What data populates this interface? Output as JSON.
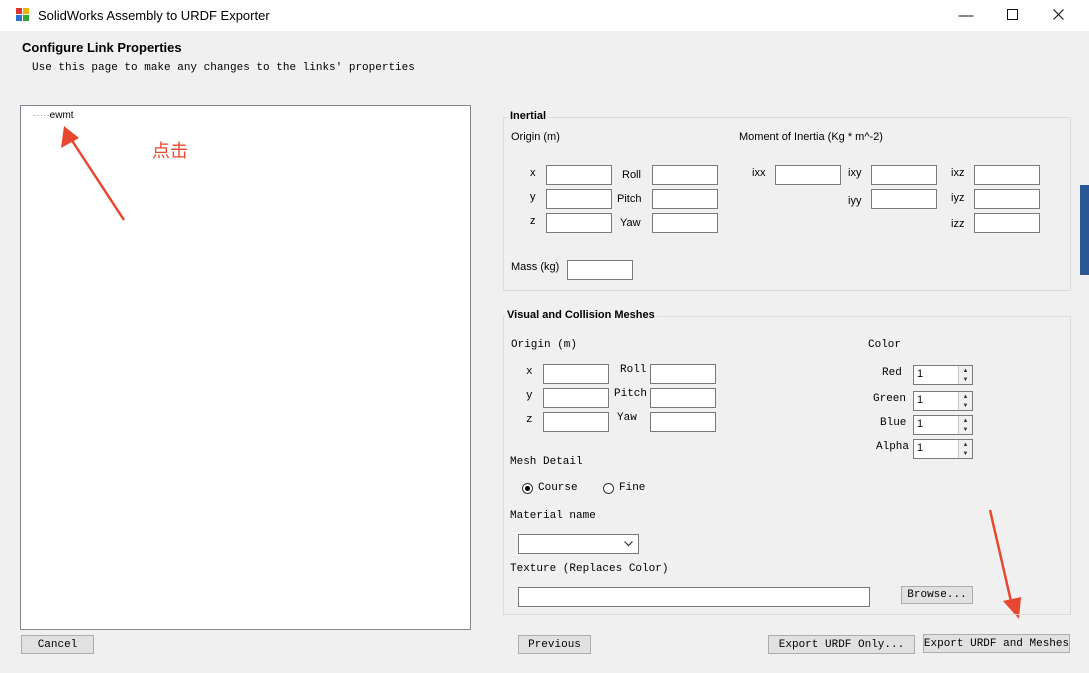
{
  "window": {
    "title": "SolidWorks Assembly to URDF Exporter"
  },
  "header": {
    "title": "Configure Link Properties",
    "subtitle": "Use this page to make any changes to the links' properties"
  },
  "tree": {
    "prefix": "·····",
    "root": "ewmt"
  },
  "annotation": {
    "text": "点击"
  },
  "inertial": {
    "title": "Inertial",
    "origin_label": "Origin (m)",
    "moment_label": "Moment of Inertia (Kg * m^-2)",
    "x": "x",
    "y": "y",
    "z": "z",
    "roll": "Roll",
    "pitch": "Pitch",
    "yaw": "Yaw",
    "ixx": "ixx",
    "ixy": "ixy",
    "ixz": "ixz",
    "iyy": "iyy",
    "iyz": "iyz",
    "izz": "izz",
    "mass_label": "Mass (kg)"
  },
  "visual": {
    "title": "Visual and Collision Meshes",
    "origin_label": "Origin (m)",
    "x": "x",
    "y": "y",
    "z": "z",
    "roll": "Roll",
    "pitch": "Pitch",
    "yaw": "Yaw",
    "color_label": "Color",
    "red_label": "Red",
    "green_label": "Green",
    "blue_label": "Blue",
    "alpha_label": "Alpha",
    "red": "1",
    "green": "1",
    "blue": "1",
    "alpha": "1",
    "mesh_detail_label": "Mesh Detail",
    "course": "Course",
    "fine": "Fine",
    "selected_detail": "Course",
    "material_label": "Material name",
    "texture_label": "Texture (Replaces Color)",
    "browse": "Browse..."
  },
  "footer": {
    "cancel": "Cancel",
    "previous": "Previous",
    "export_urdf": "Export URDF Only...",
    "export_meshes": "Export URDF and Meshes"
  },
  "colors": {
    "annotation": "#e8472f"
  }
}
